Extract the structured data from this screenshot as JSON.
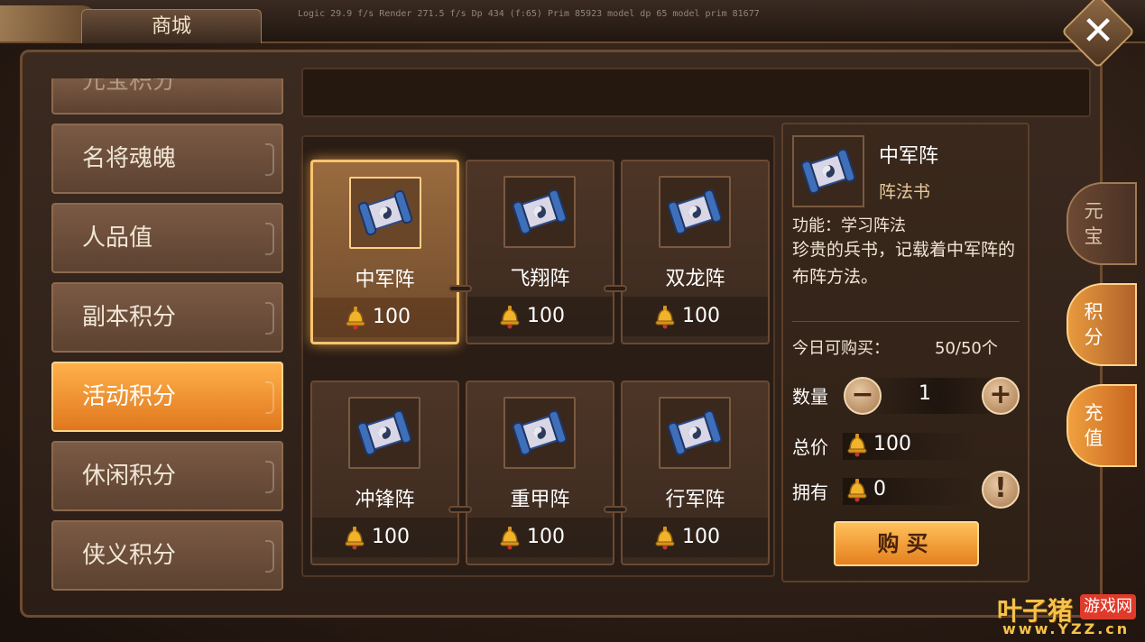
{
  "header": {
    "title": "商城",
    "debug_text": "Logic 29.9 f/s  Render 271.5 f/s  Dp 434 (f:65)  Prim 85923  model dp 65  model prim 81677"
  },
  "sidebar": {
    "partial_item": "元宝积分",
    "items": [
      {
        "label": "名将魂魄",
        "active": false
      },
      {
        "label": "人品值",
        "active": false
      },
      {
        "label": "副本积分",
        "active": false
      },
      {
        "label": "活动积分",
        "active": true
      },
      {
        "label": "休闲积分",
        "active": false
      },
      {
        "label": "侠义积分",
        "active": false
      }
    ]
  },
  "shop": {
    "items": [
      {
        "name": "中军阵",
        "price": "100",
        "selected": true
      },
      {
        "name": "飞翔阵",
        "price": "100",
        "selected": false
      },
      {
        "name": "双龙阵",
        "price": "100",
        "selected": false
      },
      {
        "name": "冲锋阵",
        "price": "100",
        "selected": false
      },
      {
        "name": "重甲阵",
        "price": "100",
        "selected": false
      },
      {
        "name": "行军阵",
        "price": "100",
        "selected": false
      }
    ]
  },
  "detail": {
    "title": "中军阵",
    "subtitle": "阵法书",
    "function": "功能：学习阵法",
    "description": "珍贵的兵书，记载着中军阵的布阵方法。",
    "today_label": "今日可购买：",
    "today_value": "50/50个",
    "quantity_label": "数量",
    "quantity_value": "1",
    "total_label": "总价",
    "total_value": "100",
    "own_label": "拥有",
    "own_value": "0",
    "buy_label": "购买",
    "minus_symbol": "−",
    "plus_symbol": "+",
    "info_symbol": "!"
  },
  "right_tabs": [
    {
      "label": "元\n宝",
      "state": "normal"
    },
    {
      "label": "积\n分",
      "state": "active"
    },
    {
      "label": "充\n值",
      "state": "gold"
    }
  ],
  "watermark": {
    "main": "叶子猪",
    "badge": "游戏网",
    "url": "www.YZZ.cn"
  },
  "colors": {
    "accent": "#e0781e",
    "gold": "#ffc46e"
  }
}
